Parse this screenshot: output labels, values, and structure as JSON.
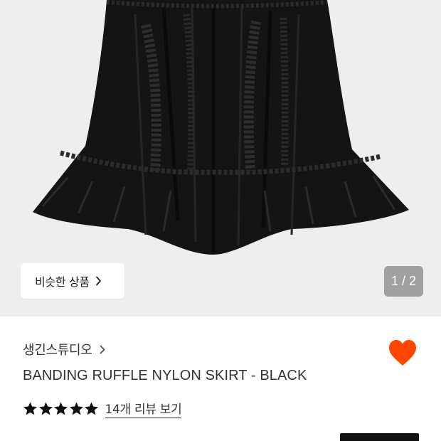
{
  "gallery": {
    "image_alt": "black banding ruffle nylon skirt",
    "similar_button": {
      "label": "비슷한 상품",
      "icon": "chevron-right-icon"
    },
    "page_indicator": "1 / 2",
    "background": "#eeeeee"
  },
  "product": {
    "brand": "생긴스튜디오",
    "brand_icon": "chevron-right-icon",
    "name": "BANDING RUFFLE NYLON SKIRT - BLACK",
    "rating": {
      "stars_filled": 5,
      "stars_total": 5
    },
    "review_link": "14개 리뷰 보기",
    "like_icon": "heart-icon",
    "like_color": "#ff4500"
  },
  "colors": {
    "text": "#333333",
    "button_dark": "#111111"
  }
}
